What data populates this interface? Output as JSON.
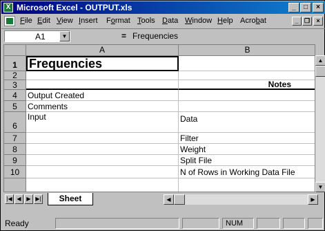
{
  "window": {
    "title": "Microsoft Excel - OUTPUT.xls",
    "buttons": {
      "minimize": "_",
      "maximize": "□",
      "close": "×"
    }
  },
  "menu": {
    "items": [
      {
        "pre": "",
        "u": "F",
        "post": "ile"
      },
      {
        "pre": "",
        "u": "E",
        "post": "dit"
      },
      {
        "pre": "",
        "u": "V",
        "post": "iew"
      },
      {
        "pre": "",
        "u": "I",
        "post": "nsert"
      },
      {
        "pre": "F",
        "u": "o",
        "post": "rmat"
      },
      {
        "pre": "",
        "u": "T",
        "post": "ools"
      },
      {
        "pre": "",
        "u": "D",
        "post": "ata"
      },
      {
        "pre": "",
        "u": "W",
        "post": "indow"
      },
      {
        "pre": "",
        "u": "H",
        "post": "elp"
      },
      {
        "pre": "Acro",
        "u": "b",
        "post": "at"
      }
    ],
    "doc_buttons": {
      "minimize": "_",
      "restore": "❐",
      "close": "×"
    }
  },
  "formula_bar": {
    "name_box": "A1",
    "equals": "=",
    "content": "Frequencies"
  },
  "sheet": {
    "columns": [
      "A",
      "B"
    ],
    "rows": [
      {
        "num": "1",
        "a": "Frequencies",
        "b": ""
      },
      {
        "num": "2",
        "a": "",
        "b": ""
      },
      {
        "num": "3",
        "a": "",
        "b": "Notes"
      },
      {
        "num": "4",
        "a": "Output Created",
        "b": ""
      },
      {
        "num": "5",
        "a": "Comments",
        "b": ""
      },
      {
        "num": "6",
        "a": "Input",
        "b": "Data"
      },
      {
        "num": "7",
        "a": "",
        "b": "Filter"
      },
      {
        "num": "8",
        "a": "",
        "b": "Weight"
      },
      {
        "num": "9",
        "a": "",
        "b": "Split File"
      },
      {
        "num": "10",
        "a": "",
        "b": "N of Rows in Working Data File"
      }
    ]
  },
  "tabs": {
    "sheet_name": "Sheet"
  },
  "status": {
    "ready": "Ready",
    "num": "NUM"
  }
}
